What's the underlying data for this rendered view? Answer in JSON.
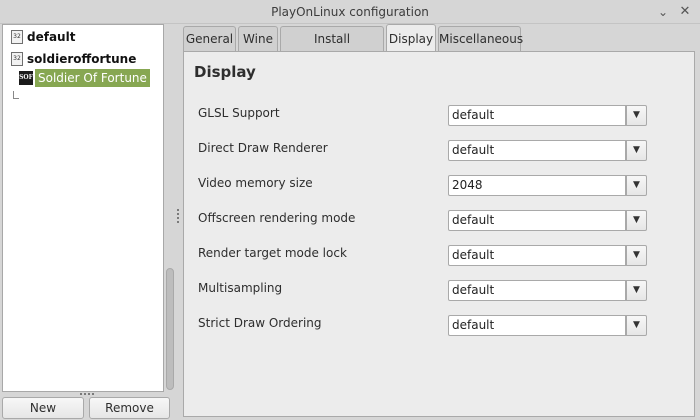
{
  "window": {
    "title": "PlayOnLinux configuration",
    "minimize_glyph": "⌄",
    "close_glyph": "✕"
  },
  "tree": {
    "items": [
      {
        "label": "default",
        "icon": "wine-32bit-icon",
        "icon_text": "32"
      },
      {
        "label": "soldieroffortune",
        "icon": "wine-32bit-icon",
        "icon_text": "32"
      }
    ],
    "child": {
      "label": "Soldier Of Fortune",
      "icon": "soldier-of-fortune-icon",
      "icon_text": "SOF"
    }
  },
  "buttons": {
    "new": "New",
    "remove": "Remove"
  },
  "tabs": [
    "General",
    "Wine",
    "Install components",
    "Display",
    "Miscellaneous"
  ],
  "active_tab": "Display",
  "panel": {
    "title": "Display",
    "rows": [
      {
        "label": "GLSL Support",
        "value": "default"
      },
      {
        "label": "Direct Draw Renderer",
        "value": "default"
      },
      {
        "label": "Video memory size",
        "value": "2048"
      },
      {
        "label": "Offscreen rendering mode",
        "value": "default"
      },
      {
        "label": "Render target mode lock",
        "value": "default"
      },
      {
        "label": "Multisampling",
        "value": "default"
      },
      {
        "label": "Strict Draw Ordering",
        "value": "default"
      }
    ],
    "dropdown_glyph": "▼"
  },
  "colors": {
    "selection": "#87a752",
    "background": "#d6d6d6",
    "panel": "#ececec"
  }
}
